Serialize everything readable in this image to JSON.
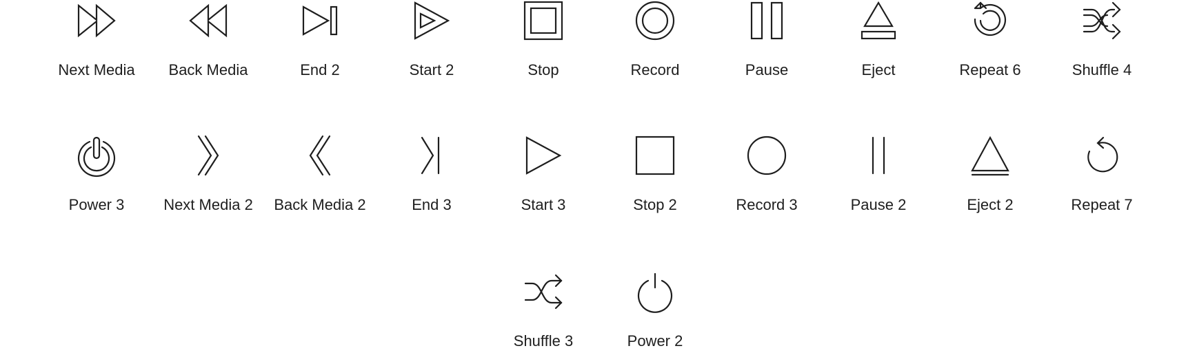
{
  "icons": [
    {
      "label": "Next Media",
      "icon": "next-media-icon"
    },
    {
      "label": "Back Media",
      "icon": "back-media-icon"
    },
    {
      "label": "End 2",
      "icon": "end-icon"
    },
    {
      "label": "Start 2",
      "icon": "start-icon"
    },
    {
      "label": "Stop",
      "icon": "stop-icon"
    },
    {
      "label": "Record",
      "icon": "record-icon"
    },
    {
      "label": "Pause",
      "icon": "pause-icon"
    },
    {
      "label": "Eject",
      "icon": "eject-icon"
    },
    {
      "label": "Repeat 6",
      "icon": "repeat-icon"
    },
    {
      "label": "Shuffle 4",
      "icon": "shuffle-icon"
    },
    {
      "label": "Power 3",
      "icon": "power-icon"
    },
    {
      "label": "Next Media 2",
      "icon": "next-chevrons-icon"
    },
    {
      "label": "Back Media 2",
      "icon": "back-chevrons-icon"
    },
    {
      "label": "End 3",
      "icon": "end-thin-icon"
    },
    {
      "label": "Start 3",
      "icon": "play-icon"
    },
    {
      "label": "Stop 2",
      "icon": "stop-square-icon"
    },
    {
      "label": "Record 3",
      "icon": "record-circle-icon"
    },
    {
      "label": "Pause 2",
      "icon": "pause-thin-icon"
    },
    {
      "label": "Eject 2",
      "icon": "eject-thin-icon"
    },
    {
      "label": "Repeat 7",
      "icon": "repeat-thin-icon"
    },
    {
      "label": "Shuffle 3",
      "icon": "shuffle-thin-icon"
    },
    {
      "label": "Power 2",
      "icon": "power-thin-icon"
    }
  ],
  "colors": {
    "background": "#ffffff",
    "stroke": "#1e1e1e",
    "text": "#1e1e1e"
  }
}
